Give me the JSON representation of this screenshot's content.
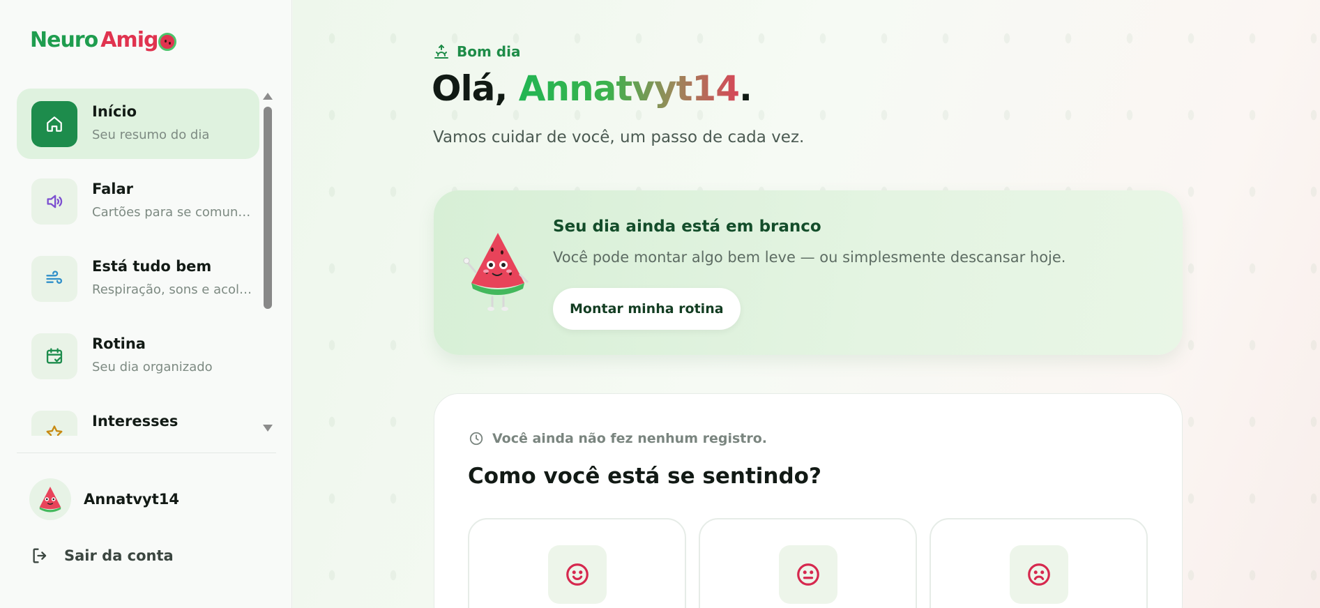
{
  "brand": {
    "part1": "Neuro",
    "part2": "Amig"
  },
  "sidebar": {
    "items": [
      {
        "title": "Início",
        "subtitle": "Seu resumo do dia",
        "icon": "home-icon"
      },
      {
        "title": "Falar",
        "subtitle": "Cartões para se comunicar",
        "icon": "speaker-icon"
      },
      {
        "title": "Está tudo bem",
        "subtitle": "Respiração, sons e acolhimento",
        "icon": "wind-icon"
      },
      {
        "title": "Rotina",
        "subtitle": "Seu dia organizado",
        "icon": "calendar-check-icon"
      },
      {
        "title": "Interesses",
        "subtitle": "",
        "icon": "star-icon"
      }
    ],
    "user": {
      "name": "Annatvyt14"
    },
    "logout_label": "Sair da conta"
  },
  "main": {
    "greeting": "Bom dia",
    "hello_prefix": "Olá, ",
    "hello_name": "Annatvyt14",
    "hello_suffix": ".",
    "subtitle": "Vamos cuidar de você, um passo de cada vez.",
    "banner": {
      "title": "Seu dia ainda está em branco",
      "text": "Você pode montar algo bem leve — ou simplesmente descansar hoje.",
      "button": "Montar minha rotina"
    },
    "mood": {
      "status": "Você ainda não fez nenhum registro.",
      "title": "Como você está se sentindo?",
      "options": [
        "happy-face-icon",
        "neutral-face-icon",
        "sad-face-icon"
      ]
    }
  },
  "colors": {
    "brand_green": "#1f9d4f",
    "brand_red": "#e0334f",
    "active_nav_bg": "#dff2df",
    "mood_face": "#d6284e"
  }
}
